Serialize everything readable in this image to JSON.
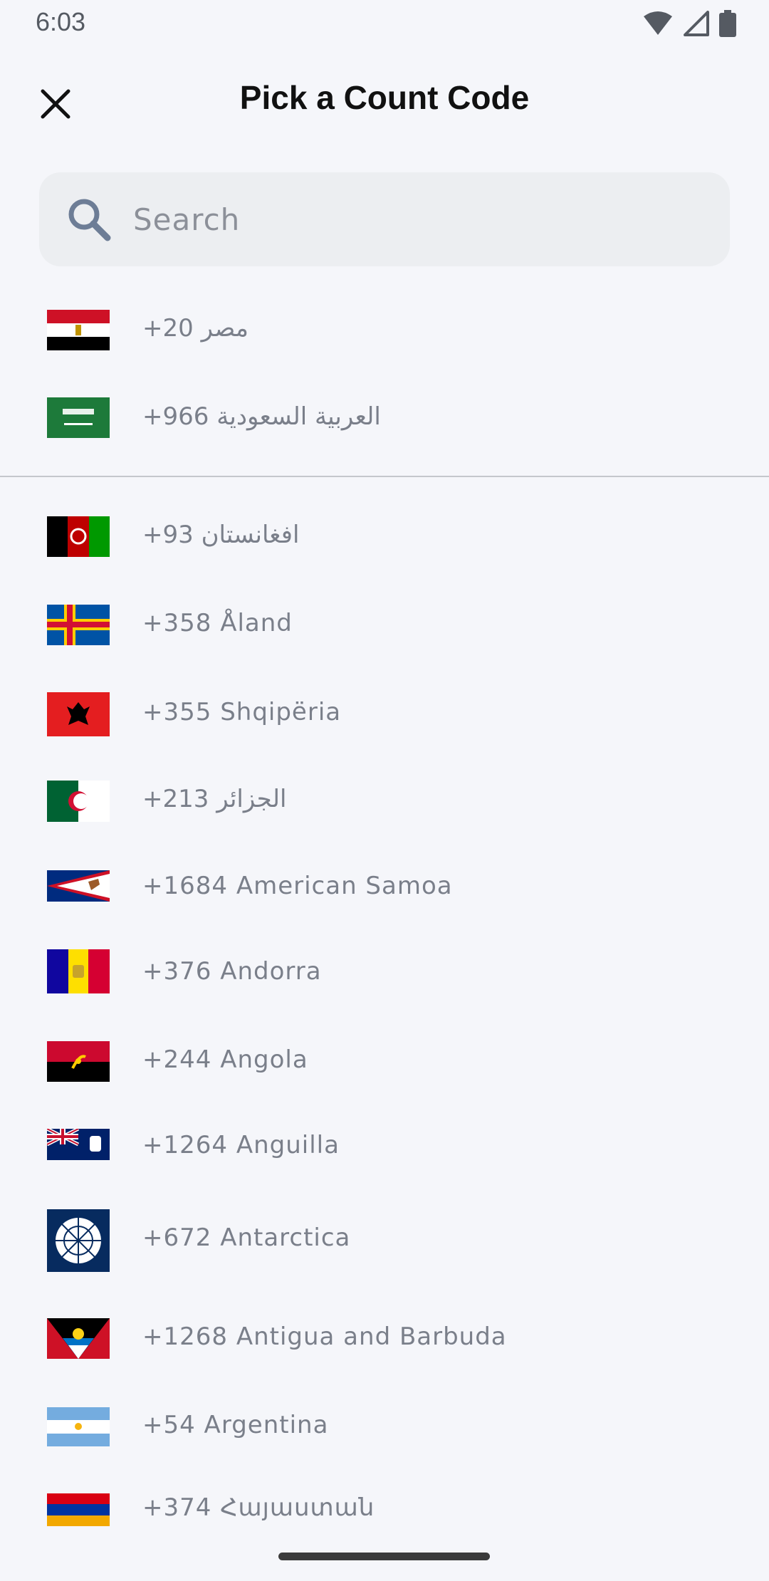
{
  "status_bar": {
    "time": "6:03",
    "icons": [
      "wifi-icon",
      "signal-icon",
      "battery-icon"
    ]
  },
  "header": {
    "title": "Pick a Count Code",
    "close_icon": "close-icon"
  },
  "search": {
    "placeholder": "Search",
    "value": "",
    "icon": "search-icon"
  },
  "pinned": [
    {
      "label": "+20 مصر",
      "flag": "Egypt"
    },
    {
      "label": "+966 العربية السعودية",
      "flag": "Saudi Arabia"
    }
  ],
  "countries": [
    {
      "label": "+93 افغانستان",
      "flag": "Afghanistan"
    },
    {
      "label": "+358 Åland",
      "flag": "Åland"
    },
    {
      "label": "+355 Shqipëria",
      "flag": "Albania"
    },
    {
      "label": "+213 الجزائر",
      "flag": "Algeria"
    },
    {
      "label": "+1684 American Samoa",
      "flag": "American Samoa"
    },
    {
      "label": "+376 Andorra",
      "flag": "Andorra"
    },
    {
      "label": "+244 Angola",
      "flag": "Angola"
    },
    {
      "label": "+1264 Anguilla",
      "flag": "Anguilla"
    },
    {
      "label": "+672 Antarctica",
      "flag": "Antarctica"
    },
    {
      "label": "+1268 Antigua and Barbuda",
      "flag": "Antigua and Barbuda"
    },
    {
      "label": "+54 Argentina",
      "flag": "Argentina"
    },
    {
      "label": "+374 Հայաստան",
      "flag": "Armenia"
    }
  ],
  "colors": {
    "background": "#f5f6fa",
    "search_bg": "#eceef1",
    "label": "#7a7f8a",
    "title": "#111111"
  }
}
